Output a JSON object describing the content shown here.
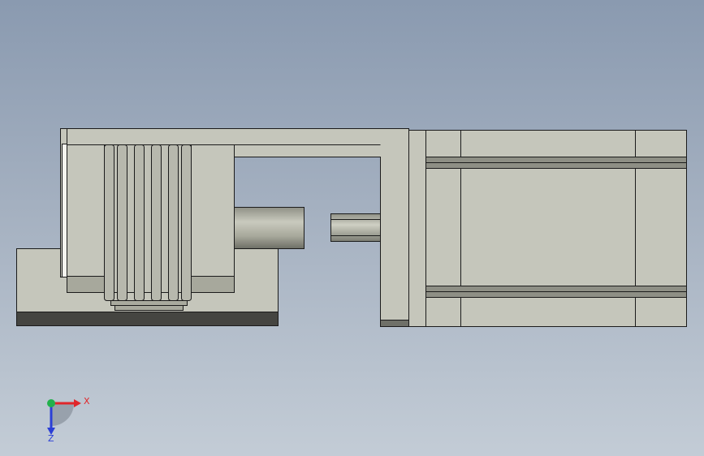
{
  "viewport": {
    "name": "cad-graphics-area",
    "colors": {
      "background_top": "#8a9ab0",
      "background_bottom": "#c3ccd6",
      "body_fill": "#c5c6bb",
      "body_shadow": "#a7a89c",
      "edge": "#1b1b1b",
      "base_dark": "#454541"
    }
  },
  "triad": {
    "x_label": "X",
    "z_label": "Z",
    "x_color": "#e0262a",
    "y_color": "#22b14c",
    "z_color": "#2b3fd6"
  }
}
